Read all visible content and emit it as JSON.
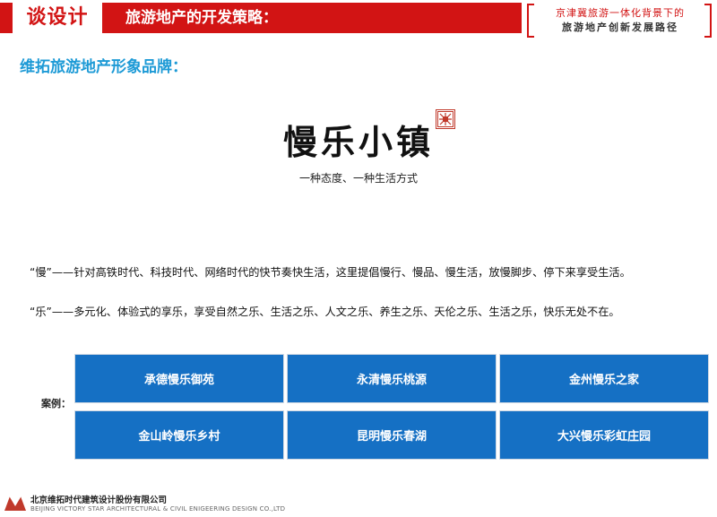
{
  "header": {
    "tab_label": "谈设计",
    "title": "旅游地产的开发策略：",
    "right_line1": "京津冀旅游一体化背景下的",
    "right_line2": "旅游地产创新发展路径"
  },
  "section_title": "维拓旅游地产形象品牌：",
  "brand": {
    "title": "慢乐小镇",
    "subtitle": "一种态度、一种生活方式"
  },
  "paragraphs": [
    "“慢”——针对高铁时代、科技时代、网络时代的快节奏快生活，这里提倡慢行、慢品、慢生活，放慢脚步、停下来享受生活。",
    "“乐”——多元化、体验式的享乐，享受自然之乐、生活之乐、人文之乐、养生之乐、天伦之乐、生活之乐，快乐无处不在。"
  ],
  "cases": {
    "label": "案例：",
    "items": [
      "承德慢乐御苑",
      "永清慢乐桃源",
      "金州慢乐之家",
      "金山岭慢乐乡村",
      "昆明慢乐春湖",
      "大兴慢乐彩虹庄园"
    ]
  },
  "footer": {
    "company_cn": "北京维拓时代建筑设计股份有限公司",
    "company_en": "BEIJING VICTORY STAR ARCHITECTURAL & CIVIL ENIGEERING DESIGN CO.,LTD"
  },
  "colors": {
    "accent_red": "#d21414",
    "section_blue": "#1d9ad6",
    "case_blue": "#1570c4"
  }
}
